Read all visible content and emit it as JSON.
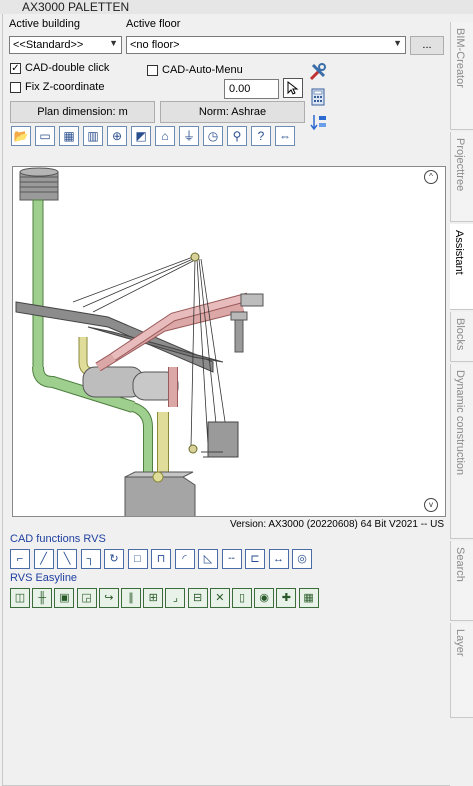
{
  "window": {
    "title": "AX3000 PALETTEN"
  },
  "labels": {
    "active_building": "Active building",
    "active_floor": "Active floor"
  },
  "building_select": {
    "value": "<<Standard>>"
  },
  "floor_select": {
    "value": "<no floor>"
  },
  "floor_more_button": "...",
  "options": {
    "cad_double_click": {
      "label": "CAD-double click",
      "checked": true
    },
    "cad_auto_menu": {
      "label": "CAD-Auto-Menu",
      "checked": false
    },
    "fix_z": {
      "label": "Fix Z-coordinate",
      "checked": false
    },
    "z_value": "0.00"
  },
  "buttons": {
    "plan_dimension": "Plan dimension: m",
    "norm": "Norm: Ashrae"
  },
  "toolbar_icons": [
    "open-folder-icon",
    "duct-icon",
    "duct-fitting-icon",
    "radiator-icon",
    "valve-icon",
    "graph-icon",
    "house-icon",
    "funnel-icon",
    "clock-icon",
    "zoom-icon",
    "help-icon",
    "switch-icon"
  ],
  "version": "Version: AX3000 (20220608) 64 Bit V2021   -- US",
  "sections": {
    "cad_functions": {
      "title": "CAD functions RVS",
      "tools": [
        "stair-icon",
        "line-icon",
        "diagonal-icon",
        "branch-icon",
        "rotate-icon",
        "rectangle-icon",
        "connect-icon",
        "arc-icon",
        "measure-icon",
        "dash-icon",
        "offset-icon",
        "dimension-icon",
        "globe-icon"
      ]
    },
    "easyline": {
      "title": "RVS Easyline",
      "tools": [
        "fitting-icon",
        "pipe-rack-icon",
        "square-valve-icon",
        "diag-box-icon",
        "bend-icon",
        "parallel-icon",
        "align-icon",
        "elbow-icon",
        "connector-icon",
        "delete-icon",
        "cylinder-icon",
        "color-wheel-icon",
        "cross-icon",
        "grid-icon"
      ]
    }
  },
  "tabs": [
    "BIM-Creator",
    "Projecttree",
    "Assistant",
    "Blocks",
    "Dynamic construction",
    "Search",
    "Layer"
  ],
  "active_tab": "Assistant"
}
